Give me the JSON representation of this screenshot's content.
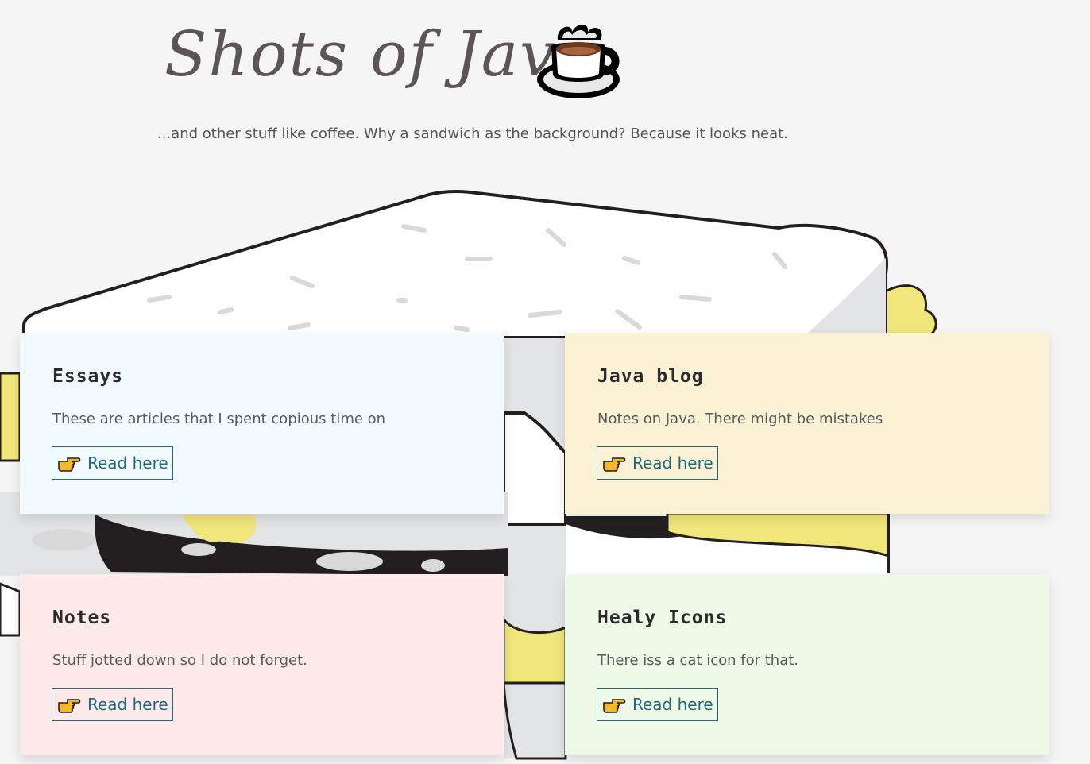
{
  "header": {
    "title": "Shots of Java",
    "tagline": "...and other stuff like coffee. Why a sandwich as the background? Because it looks neat.",
    "logo_icon": "coffee-cup-icon"
  },
  "cards": [
    {
      "title": "Essays",
      "description": "These are articles that I spent copious time on",
      "link_label": "Read here",
      "link_icon": "pointing-hand-icon",
      "background": "#f3fafd"
    },
    {
      "title": "Java blog",
      "description": "Notes on Java. There might be mistakes",
      "link_label": "Read here",
      "link_icon": "pointing-hand-icon",
      "background": "#fbf2d6"
    },
    {
      "title": "Notes",
      "description": "Stuff jotted down so I do not forget.",
      "link_label": "Read here",
      "link_icon": "pointing-hand-icon",
      "background": "#feeaea"
    },
    {
      "title": "Healy Icons",
      "description": "There iss a cat icon for that.",
      "link_label": "Read here",
      "link_icon": "pointing-hand-icon",
      "background": "#eef9e8"
    }
  ],
  "colors": {
    "page_background": "#f5f5f5",
    "link": "#1e6a7c",
    "title": "#5d5555",
    "sandwich_outline": "#231f20",
    "lettuce": "#f0e67a"
  }
}
